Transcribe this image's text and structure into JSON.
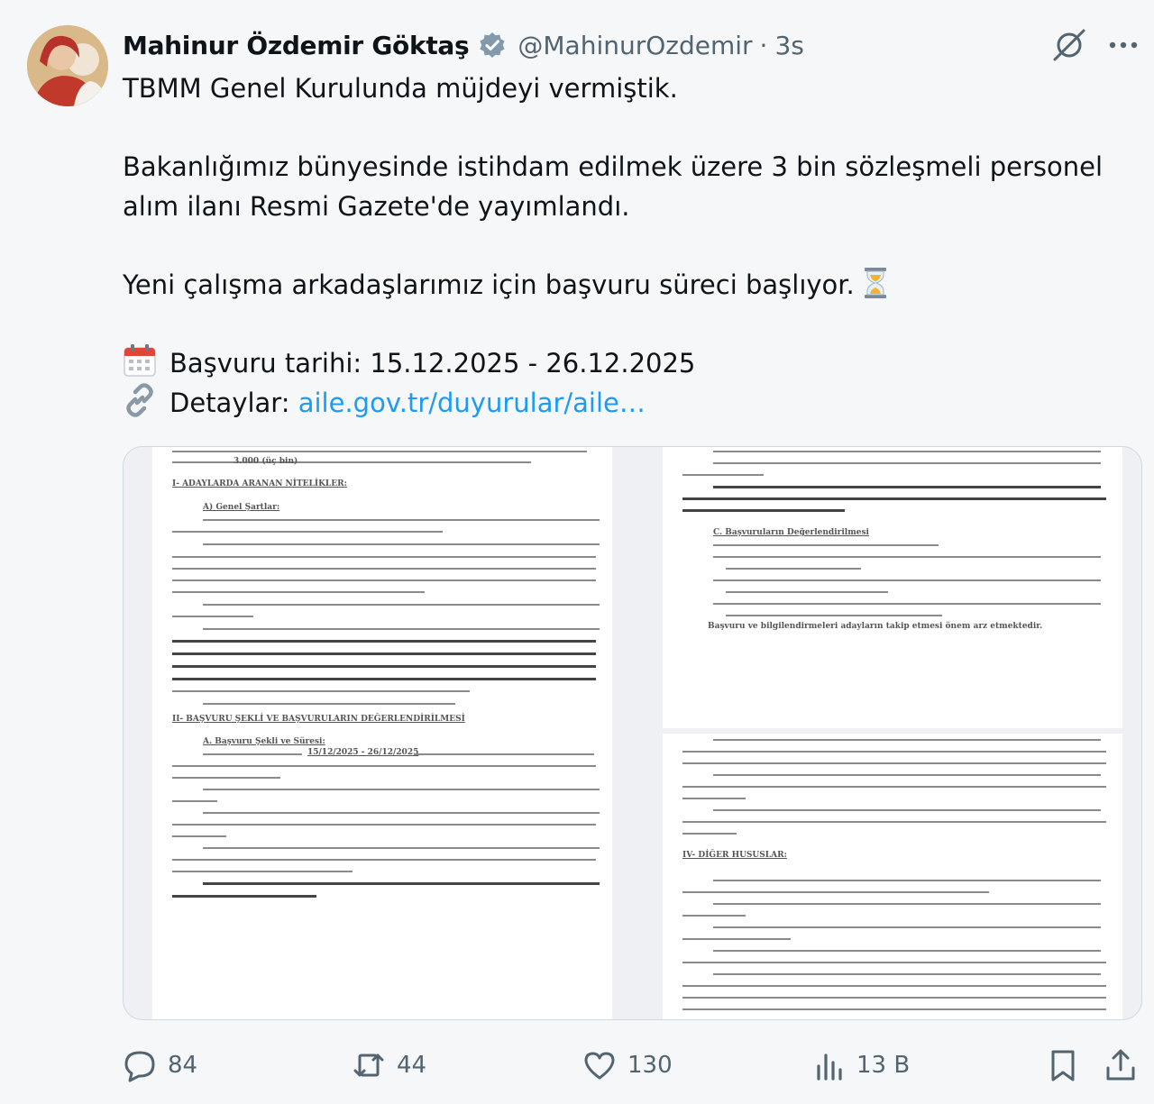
{
  "author": {
    "name": "Mahinur Özdemir Göktaş",
    "handle": "@MahinurOzdemir",
    "separator": "·",
    "time": "3s",
    "verified": true
  },
  "tweet": {
    "line1": "TBMM Genel Kurulunda müjdeyi vermiştik.",
    "line2": "Bakanlığımız bünyesinde istihdam edilmek üzere 3 bin sözleşmeli personel",
    "line3": "alım ilanı Resmi Gazete'de yayımlandı.",
    "line4": "Yeni çalışma arkadaşlarımız için başvuru süreci başlıyor.",
    "date_text": "Başvuru tarihi: 15.12.2025 - 26.12.2025",
    "details_label": "Detaylar:",
    "details_link": "aile.gov.tr/duyurular/aile…"
  },
  "icons": {
    "header": [
      "verified-icon",
      "grok-icon",
      "more-icon"
    ],
    "inline": [
      "hourglass-icon",
      "calendar-icon",
      "link-icon"
    ],
    "actions": [
      "reply-icon",
      "retweet-icon",
      "like-icon",
      "views-icon",
      "bookmark-icon",
      "share-icon"
    ]
  },
  "media": {
    "left_page": {
      "intro_bold": "3.000 (üç bin)",
      "section1": "I- ADAYLARDA ARANAN NİTELİKLER:",
      "subsection_a": "A) Genel Şartlar:",
      "section2": "II- BAŞVURU ŞEKLİ VE BAŞVURULARIN DEĞERLENDİRİLMESİ",
      "subsection_b": "A. Başvuru Şekli ve Süresi:",
      "dates": "15/12/2025 - 26/12/2025"
    },
    "right_page_top": {
      "subsection": "C. Başvuruların Değerlendirilmesi",
      "closing": "Başvuru ve bilgilendirmeleri adayların takip etmesi önem arz etmektedir."
    },
    "right_page_bottom": {
      "section4": "IV- DİĞER HUSUSLAR:"
    }
  },
  "actions": {
    "replies": "84",
    "retweets": "44",
    "likes": "130",
    "views": "13 B"
  },
  "colors": {
    "accent": "#1d9bf0",
    "muted": "#536471",
    "background": "#f6f7f9"
  }
}
